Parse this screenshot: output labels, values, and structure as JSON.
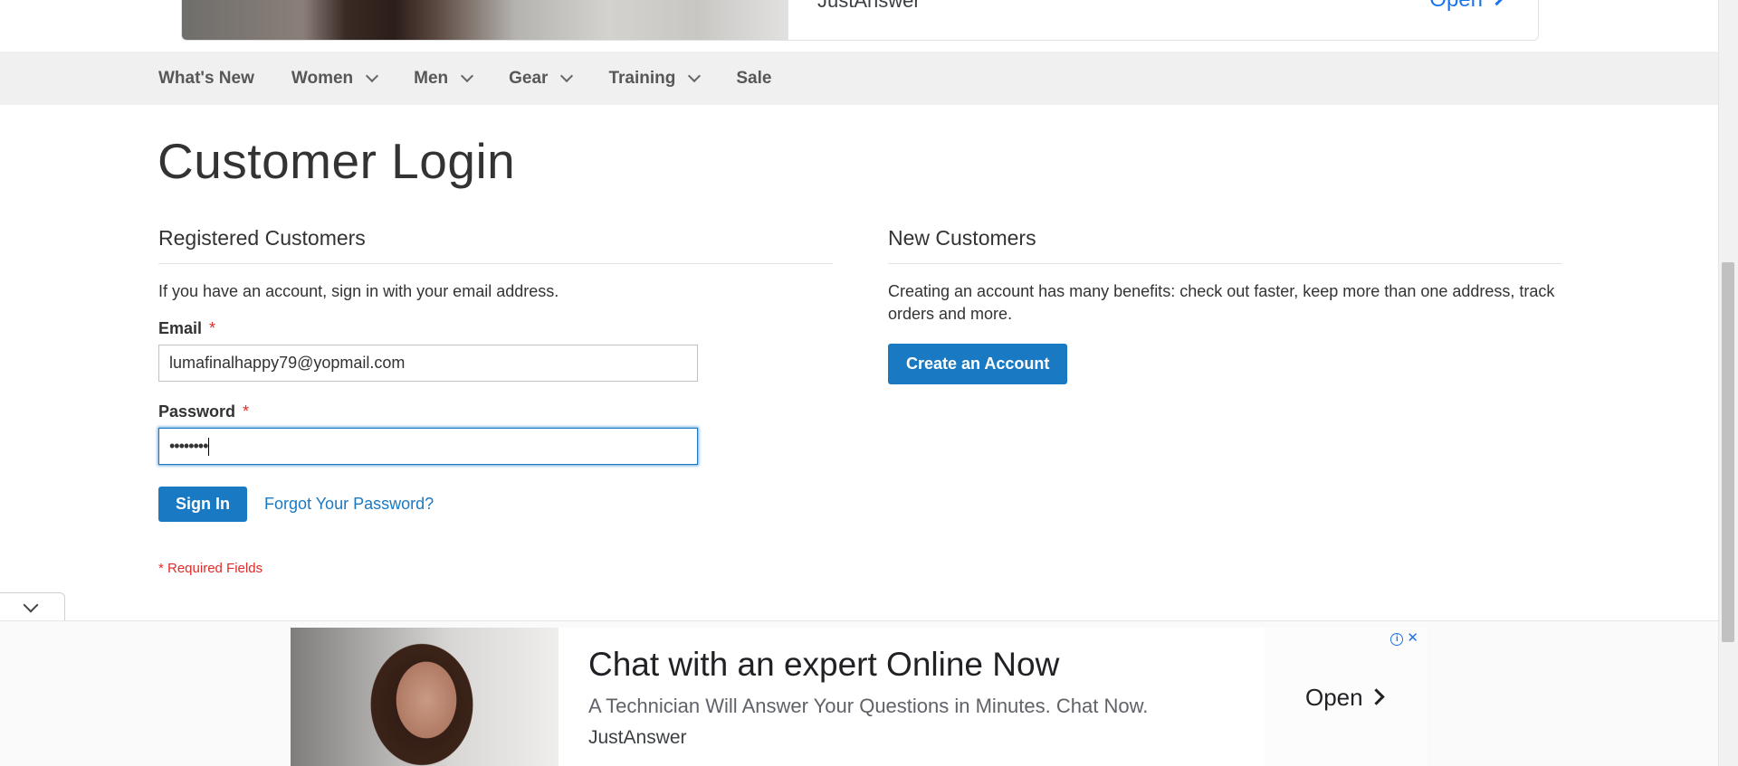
{
  "top_ad": {
    "brand": "JustAnswer",
    "open_label": "Open"
  },
  "nav": {
    "items": [
      {
        "label": "What's New",
        "has_caret": false
      },
      {
        "label": "Women",
        "has_caret": true
      },
      {
        "label": "Men",
        "has_caret": true
      },
      {
        "label": "Gear",
        "has_caret": true
      },
      {
        "label": "Training",
        "has_caret": true
      },
      {
        "label": "Sale",
        "has_caret": false
      }
    ]
  },
  "page": {
    "title": "Customer Login"
  },
  "registered": {
    "title": "Registered Customers",
    "intro": "If you have an account, sign in with your email address.",
    "email_label": "Email",
    "email_value": "lumafinalhappy79@yopmail.com",
    "password_label": "Password",
    "password_value": "••••••••",
    "required_mark": "*",
    "sign_in_label": "Sign In",
    "forgot_label": "Forgot Your Password?",
    "required_note": "* Required Fields"
  },
  "new_customers": {
    "title": "New Customers",
    "text": "Creating an account has many benefits: check out faster, keep more than one address, track orders and more.",
    "create_label": "Create an Account"
  },
  "bottom_ad": {
    "headline": "Chat with an expert Online Now",
    "description": "A Technician Will Answer Your Questions in Minutes. Chat Now.",
    "brand": "JustAnswer",
    "open_label": "Open",
    "close_glyph": "✕"
  },
  "colors": {
    "primary": "#1979c3",
    "required": "#e02b27",
    "nav_bg": "#f0f0f0",
    "ad_link": "#1a73e8"
  }
}
